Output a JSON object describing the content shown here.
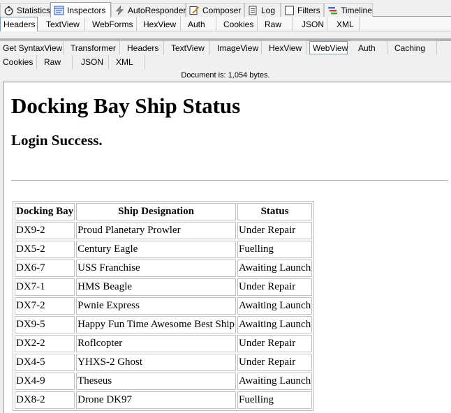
{
  "main_tabs": [
    {
      "label": "Statistics",
      "icon": "stopwatch-icon"
    },
    {
      "label": "Inspectors",
      "icon": "inspectors-icon"
    },
    {
      "label": "AutoResponder",
      "icon": "lightning-icon"
    },
    {
      "label": "Composer",
      "icon": "compose-icon"
    },
    {
      "label": "Log",
      "icon": "log-icon"
    },
    {
      "label": "Filters",
      "icon": "checkbox-icon"
    },
    {
      "label": "Timeline",
      "icon": "timeline-icon"
    }
  ],
  "request_tabs": [
    "Headers",
    "TextView",
    "WebForms",
    "HexView",
    "Auth",
    "Cookies",
    "Raw",
    "JSON",
    "XML"
  ],
  "response_tabs_row1": [
    "Get SyntaxView",
    "Transformer",
    "Headers",
    "TextView",
    "ImageView",
    "HexView",
    "WebView",
    "Auth",
    "Caching"
  ],
  "response_tabs_row2": [
    "Cookies",
    "Raw",
    "JSON",
    "XML"
  ],
  "document_info": "Document is: 1,054 bytes.",
  "page": {
    "heading": "Docking Bay Ship Status",
    "subheading": "Login Success.",
    "table": {
      "headers": [
        "Docking Bay",
        "Ship Designation",
        "Status"
      ],
      "rows": [
        [
          "DX9-2",
          "Proud Planetary Prowler",
          "Under Repair"
        ],
        [
          "DX5-2",
          "Century Eagle",
          "Fuelling"
        ],
        [
          "DX6-7",
          "USS Franchise",
          "Awaiting Launch"
        ],
        [
          "DX7-1",
          "HMS Beagle",
          "Under Repair"
        ],
        [
          "DX7-2",
          "Pwnie Express",
          "Awaiting Launch"
        ],
        [
          "DX9-5",
          "Happy Fun Time Awesome Best Ship",
          "Awaiting Launch"
        ],
        [
          "DX2-2",
          "Roflcopter",
          "Under Repair"
        ],
        [
          "DX4-5",
          "YHXS-2 Ghost",
          "Under Repair"
        ],
        [
          "DX4-9",
          "Theseus",
          "Awaiting Launch"
        ],
        [
          "DX8-2",
          "Drone DK97",
          "Fuelling"
        ]
      ]
    }
  },
  "colors": {
    "accent_blue": "#2a5ab8",
    "timeline_red": "#d9342b",
    "timeline_green": "#3aa34a",
    "timeline_blue": "#3b6fd4"
  }
}
